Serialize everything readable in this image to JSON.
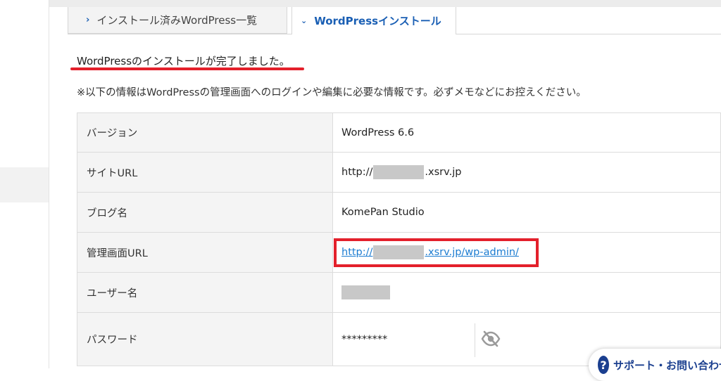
{
  "tabs": {
    "installed": {
      "chevron": "›",
      "label": "インストール済みWordPress一覧"
    },
    "install": {
      "chevron": "⌄",
      "label": "WordPressインストール"
    }
  },
  "message": {
    "done": "WordPressのインストールが完了しました。",
    "note": "※以下の情報はWordPressの管理画面へのログインや編集に必要な情報です。必ずメモなどにお控えください。"
  },
  "table": {
    "version": {
      "label": "バージョン",
      "value": "WordPress 6.6"
    },
    "site_url": {
      "label": "サイトURL",
      "prefix": "http://",
      "suffix": ".xsrv.jp"
    },
    "blog_name": {
      "label": "ブログ名",
      "value": "KomePan Studio"
    },
    "admin_url": {
      "label": "管理画面URL",
      "prefix": "http://",
      "suffix": ".xsrv.jp/wp-admin/"
    },
    "username": {
      "label": "ユーザー名"
    },
    "password": {
      "label": "パスワード",
      "value": "*********",
      "toggle_icon": "eye-slash-icon"
    }
  },
  "support": {
    "icon": "?",
    "label": "サポート・お問い合わせ"
  },
  "colors": {
    "accent_red": "#e3202b",
    "link_blue": "#1c7cd1",
    "tab_blue": "#1a5fb4",
    "support_navy": "#1b3f8f"
  }
}
